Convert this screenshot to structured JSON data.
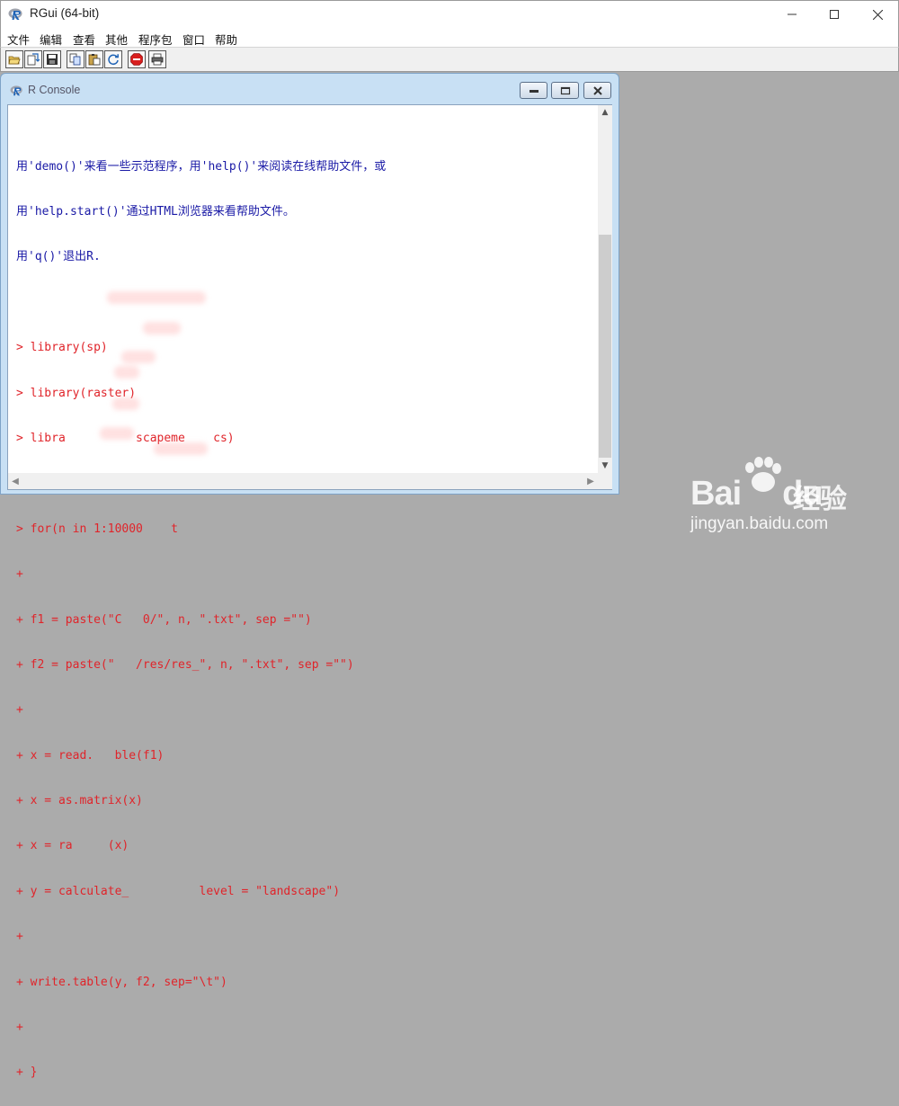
{
  "window": {
    "title": "RGui (64-bit)",
    "controls": {
      "minimize": "—",
      "maximize": "☐",
      "close": "✕"
    }
  },
  "menu": [
    "文件",
    "编辑",
    "查看",
    "其他",
    "程序包",
    "窗口",
    "帮助"
  ],
  "toolbar": {
    "buttons": [
      "open-script",
      "load-workspace",
      "save-workspace",
      "copy",
      "paste",
      "copy-paste",
      "stop",
      "print"
    ]
  },
  "console": {
    "title": "R Console",
    "output_lines": [
      "用'demo()'来看一些示范程序，用'help()'来阅读在线帮助文件，或",
      "用'help.start()'通过HTML浏览器来看帮助文件。",
      "用'q()'退出R."
    ],
    "input_lines": [
      "> library(sp)",
      "> library(raster)",
      "> libra          scapeme    cs)",
      ">",
      "> for(n in 1:10000    t",
      "+",
      "+ f1 = paste(\"C   0/\", n, \".txt\", sep =\"\")",
      "+ f2 = paste(\"   /res/res_\", n, \".txt\", sep =\"\")",
      "+",
      "+ x = read.   ble(f1)",
      "+ x = as.matrix(x)",
      "+ x = ra     (x)",
      "+ y = calculate_          level = \"landscape\")",
      "+",
      "+ write.table(y, f2, sep=\"\\t\")",
      "+",
      "+ }"
    ]
  },
  "colors": {
    "output_text": "#1a1aa6",
    "input_text": "#e0242a",
    "mdi_background": "#ababab",
    "console_frame": "#c8e0f4"
  },
  "watermark": {
    "logo_text": "Bai",
    "logo_text_2": "du",
    "jingyan": "经验",
    "url": "jingyan.baidu.com"
  }
}
